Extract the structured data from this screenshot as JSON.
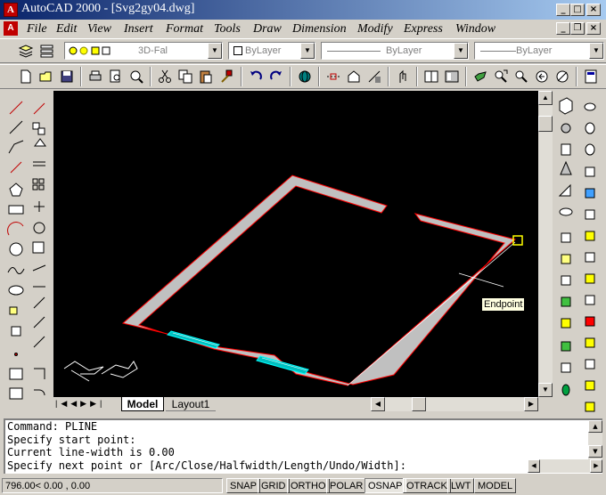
{
  "window": {
    "title": "AutoCAD 2000 - [Svg2gy04.dwg]"
  },
  "menus": [
    "File",
    "Edit",
    "View",
    "Insert",
    "Format",
    "Tools",
    "Draw",
    "Dimension",
    "Modify",
    "Express",
    "Window"
  ],
  "properties_toolbar": {
    "layer_value": "3D-Fal",
    "color_value": "ByLayer",
    "linetype_value": "ByLayer",
    "lineweight_value": "ByLayer"
  },
  "canvas": {
    "osnap_tooltip": "Endpoint"
  },
  "layout_tabs": [
    "Model",
    "Layout1"
  ],
  "command_window": {
    "lines": [
      "Command:  PLINE",
      "Specify start point:",
      "Current line-width is 0.00",
      "Specify next point or [Arc/Close/Halfwidth/Length/Undo/Width]:"
    ]
  },
  "status": {
    "coordinates": "796.00< 0.00  , 0.00",
    "toggles": [
      "SNAP",
      "GRID",
      "ORTHO",
      "POLAR",
      "OSNAP",
      "OTRACK",
      "LWT",
      "MODEL"
    ],
    "active_toggles": [
      "OSNAP"
    ]
  },
  "colors": {
    "title_start": "#0a246a",
    "title_end": "#a6caf0",
    "canvas": "#000000",
    "wall_fill": "#c0c0c0",
    "wall_edge": "#ff0000",
    "window_cyan": "#00ffff",
    "snap_marker": "#ffff00"
  }
}
